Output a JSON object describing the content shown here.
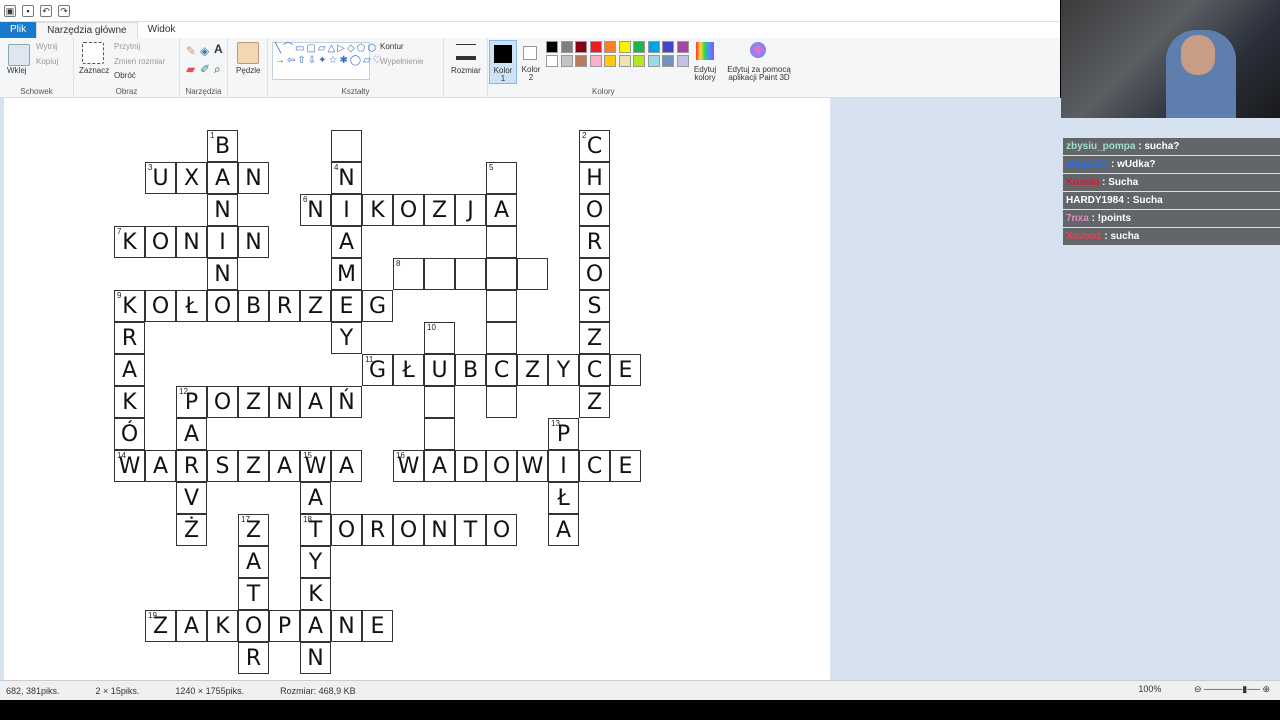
{
  "tabs": {
    "file": "Plik",
    "home": "Narzędzia główne",
    "view": "Widok"
  },
  "ribbon": {
    "clipboard": {
      "label": "Schowek",
      "paste": "Wklej",
      "cut": "Wytnij",
      "copy": "Kopiuj"
    },
    "image": {
      "label": "Obraz",
      "select": "Zaznacz",
      "crop": "Przytnij",
      "resize": "Zmień rozmiar",
      "rotate": "Obróć"
    },
    "tools": {
      "label": "Narzędzia"
    },
    "brushes": {
      "label": "Pędzle"
    },
    "shapes": {
      "label": "Kształty",
      "outline": "Kontur",
      "fill": "Wypełnienie"
    },
    "size": {
      "label": "Rozmiar"
    },
    "color1": {
      "label": "Kolor 1"
    },
    "color2": {
      "label": "Kolor 2"
    },
    "colors": {
      "label": "Kolory",
      "edit": "Edytuj kolory",
      "paint3d": "Edytuj za pomocą aplikacji Paint 3D"
    }
  },
  "palette": [
    "#000000",
    "#7f7f7f",
    "#880015",
    "#ed1c24",
    "#ff7f27",
    "#fff200",
    "#22b14c",
    "#00a2e8",
    "#3f48cc",
    "#a349a4",
    "#ffffff",
    "#c3c3c3",
    "#b97a57",
    "#ffaec9",
    "#ffc90e",
    "#efe4b0",
    "#b5e61d",
    "#99d9ea",
    "#7092be",
    "#c8bfe7"
  ],
  "crossword": [
    {
      "c": 6,
      "r": 0,
      "ch": "B",
      "n": "1"
    },
    {
      "c": 4,
      "r": 1,
      "ch": "U",
      "n": "3"
    },
    {
      "c": 5,
      "r": 1,
      "ch": "X"
    },
    {
      "c": 6,
      "r": 1,
      "ch": "A"
    },
    {
      "c": 7,
      "r": 1,
      "ch": "N"
    },
    {
      "c": 6,
      "r": 2,
      "ch": "N"
    },
    {
      "c": 3,
      "r": 3,
      "ch": "K",
      "n": "7"
    },
    {
      "c": 4,
      "r": 3,
      "ch": "O"
    },
    {
      "c": 5,
      "r": 3,
      "ch": "N"
    },
    {
      "c": 6,
      "r": 3,
      "ch": "I"
    },
    {
      "c": 7,
      "r": 3,
      "ch": "N"
    },
    {
      "c": 6,
      "r": 4,
      "ch": "N"
    },
    {
      "c": 10,
      "r": 1,
      "ch": "N",
      "n": "4"
    },
    {
      "c": 10,
      "r": 0,
      "ch": ""
    },
    {
      "c": 9,
      "r": 2,
      "ch": "N",
      "n": "6"
    },
    {
      "c": 10,
      "r": 2,
      "ch": "I"
    },
    {
      "c": 11,
      "r": 2,
      "ch": "K"
    },
    {
      "c": 12,
      "r": 2,
      "ch": "O"
    },
    {
      "c": 13,
      "r": 2,
      "ch": "Z"
    },
    {
      "c": 14,
      "r": 2,
      "ch": "J"
    },
    {
      "c": 15,
      "r": 2,
      "ch": "A"
    },
    {
      "c": 10,
      "r": 3,
      "ch": "A"
    },
    {
      "c": 10,
      "r": 4,
      "ch": "M"
    },
    {
      "c": 10,
      "r": 6,
      "ch": "Y"
    },
    {
      "c": 15,
      "r": 1,
      "ch": "",
      "n": "5"
    },
    {
      "c": 15,
      "r": 3,
      "ch": ""
    },
    {
      "c": 15,
      "r": 4,
      "ch": ""
    },
    {
      "c": 15,
      "r": 5,
      "ch": ""
    },
    {
      "c": 15,
      "r": 6,
      "ch": ""
    },
    {
      "c": 15,
      "r": 8,
      "ch": ""
    },
    {
      "c": 12,
      "r": 4,
      "ch": "",
      "n": "8"
    },
    {
      "c": 13,
      "r": 4,
      "ch": ""
    },
    {
      "c": 14,
      "r": 4,
      "ch": ""
    },
    {
      "c": 16,
      "r": 4,
      "ch": ""
    },
    {
      "c": 3,
      "r": 5,
      "ch": "K",
      "n": "9"
    },
    {
      "c": 4,
      "r": 5,
      "ch": "O"
    },
    {
      "c": 5,
      "r": 5,
      "ch": "Ł"
    },
    {
      "c": 6,
      "r": 5,
      "ch": "O"
    },
    {
      "c": 7,
      "r": 5,
      "ch": "B"
    },
    {
      "c": 8,
      "r": 5,
      "ch": "R"
    },
    {
      "c": 9,
      "r": 5,
      "ch": "Z"
    },
    {
      "c": 10,
      "r": 5,
      "ch": "E"
    },
    {
      "c": 11,
      "r": 5,
      "ch": "G"
    },
    {
      "c": 18,
      "r": 0,
      "ch": "C",
      "n": "2"
    },
    {
      "c": 18,
      "r": 1,
      "ch": "H"
    },
    {
      "c": 18,
      "r": 2,
      "ch": "O"
    },
    {
      "c": 18,
      "r": 3,
      "ch": "R"
    },
    {
      "c": 18,
      "r": 4,
      "ch": "O"
    },
    {
      "c": 18,
      "r": 5,
      "ch": "S"
    },
    {
      "c": 18,
      "r": 6,
      "ch": "Z"
    },
    {
      "c": 18,
      "r": 8,
      "ch": "Z"
    },
    {
      "c": 13,
      "r": 6,
      "ch": "",
      "n": "10"
    },
    {
      "c": 3,
      "r": 6,
      "ch": "R"
    },
    {
      "c": 3,
      "r": 7,
      "ch": "A"
    },
    {
      "c": 3,
      "r": 8,
      "ch": "K"
    },
    {
      "c": 3,
      "r": 9,
      "ch": "Ó"
    },
    {
      "c": 11,
      "r": 7,
      "ch": "G",
      "n": "11"
    },
    {
      "c": 12,
      "r": 7,
      "ch": "Ł"
    },
    {
      "c": 13,
      "r": 7,
      "ch": "U"
    },
    {
      "c": 14,
      "r": 7,
      "ch": "B"
    },
    {
      "c": 15,
      "r": 7,
      "ch": "C"
    },
    {
      "c": 16,
      "r": 7,
      "ch": "Z"
    },
    {
      "c": 17,
      "r": 7,
      "ch": "Y"
    },
    {
      "c": 18,
      "r": 7,
      "ch": "C"
    },
    {
      "c": 19,
      "r": 7,
      "ch": "E"
    },
    {
      "c": 5,
      "r": 8,
      "ch": "P",
      "n": "12"
    },
    {
      "c": 6,
      "r": 8,
      "ch": "O"
    },
    {
      "c": 7,
      "r": 8,
      "ch": "Z"
    },
    {
      "c": 8,
      "r": 8,
      "ch": "N"
    },
    {
      "c": 9,
      "r": 8,
      "ch": "A"
    },
    {
      "c": 10,
      "r": 8,
      "ch": "Ń"
    },
    {
      "c": 13,
      "r": 8,
      "ch": ""
    },
    {
      "c": 13,
      "r": 9,
      "ch": ""
    },
    {
      "c": 5,
      "r": 9,
      "ch": "A"
    },
    {
      "c": 17,
      "r": 9,
      "ch": "P",
      "n": "13"
    },
    {
      "c": 3,
      "r": 10,
      "ch": "W",
      "n": "14"
    },
    {
      "c": 4,
      "r": 10,
      "ch": "A"
    },
    {
      "c": 5,
      "r": 10,
      "ch": "R"
    },
    {
      "c": 6,
      "r": 10,
      "ch": "S"
    },
    {
      "c": 7,
      "r": 10,
      "ch": "Z"
    },
    {
      "c": 8,
      "r": 10,
      "ch": "A"
    },
    {
      "c": 9,
      "r": 10,
      "ch": "W",
      "n": "15"
    },
    {
      "c": 10,
      "r": 10,
      "ch": "A"
    },
    {
      "c": 12,
      "r": 10,
      "ch": "W",
      "n": "16"
    },
    {
      "c": 13,
      "r": 10,
      "ch": "A"
    },
    {
      "c": 14,
      "r": 10,
      "ch": "D"
    },
    {
      "c": 15,
      "r": 10,
      "ch": "O"
    },
    {
      "c": 16,
      "r": 10,
      "ch": "W"
    },
    {
      "c": 17,
      "r": 10,
      "ch": "I"
    },
    {
      "c": 18,
      "r": 10,
      "ch": "C"
    },
    {
      "c": 19,
      "r": 10,
      "ch": "E"
    },
    {
      "c": 5,
      "r": 11,
      "ch": "V"
    },
    {
      "c": 9,
      "r": 11,
      "ch": "A"
    },
    {
      "c": 17,
      "r": 11,
      "ch": "Ł"
    },
    {
      "c": 5,
      "r": 12,
      "ch": "Ż"
    },
    {
      "c": 7,
      "r": 12,
      "ch": "Z",
      "n": "17"
    },
    {
      "c": 9,
      "r": 12,
      "ch": "T",
      "n": "18"
    },
    {
      "c": 10,
      "r": 12,
      "ch": "O"
    },
    {
      "c": 11,
      "r": 12,
      "ch": "R"
    },
    {
      "c": 12,
      "r": 12,
      "ch": "O"
    },
    {
      "c": 13,
      "r": 12,
      "ch": "N"
    },
    {
      "c": 14,
      "r": 12,
      "ch": "T"
    },
    {
      "c": 15,
      "r": 12,
      "ch": "O"
    },
    {
      "c": 17,
      "r": 12,
      "ch": "A"
    },
    {
      "c": 7,
      "r": 13,
      "ch": "A"
    },
    {
      "c": 9,
      "r": 13,
      "ch": "Y"
    },
    {
      "c": 7,
      "r": 14,
      "ch": "T"
    },
    {
      "c": 9,
      "r": 14,
      "ch": "K"
    },
    {
      "c": 4,
      "r": 15,
      "ch": "Z",
      "n": "19"
    },
    {
      "c": 5,
      "r": 15,
      "ch": "A"
    },
    {
      "c": 6,
      "r": 15,
      "ch": "K"
    },
    {
      "c": 7,
      "r": 15,
      "ch": "O"
    },
    {
      "c": 8,
      "r": 15,
      "ch": "P"
    },
    {
      "c": 9,
      "r": 15,
      "ch": "A"
    },
    {
      "c": 10,
      "r": 15,
      "ch": "N"
    },
    {
      "c": 11,
      "r": 15,
      "ch": "E"
    },
    {
      "c": 7,
      "r": 16,
      "ch": "R"
    },
    {
      "c": 9,
      "r": 16,
      "ch": "N"
    }
  ],
  "chat": [
    {
      "user": "zbysiu_pompa",
      "msg": " : sucha?",
      "color": "#9fe0c8"
    },
    {
      "user": "shaja321",
      "msg": " : wUdka?",
      "color": "#2d6de0"
    },
    {
      "user": "Kusola",
      "msg": " : Sucha",
      "color": "#d21d3a"
    },
    {
      "user": "HARDY1984",
      "msg": " : Sucha",
      "color": "#ffffff"
    },
    {
      "user": "7nxa",
      "msg": " : !points",
      "color": "#d98cc7"
    },
    {
      "user": "Xavoo1",
      "msg": " : sucha",
      "color": "#e0435a"
    }
  ],
  "status": {
    "cursor": "682, 381piks.",
    "selection": "2 × 15piks.",
    "image_size": "1240 × 1755piks.",
    "file_size": "Rozmiar: 468,9 KB",
    "zoom": "100%"
  }
}
